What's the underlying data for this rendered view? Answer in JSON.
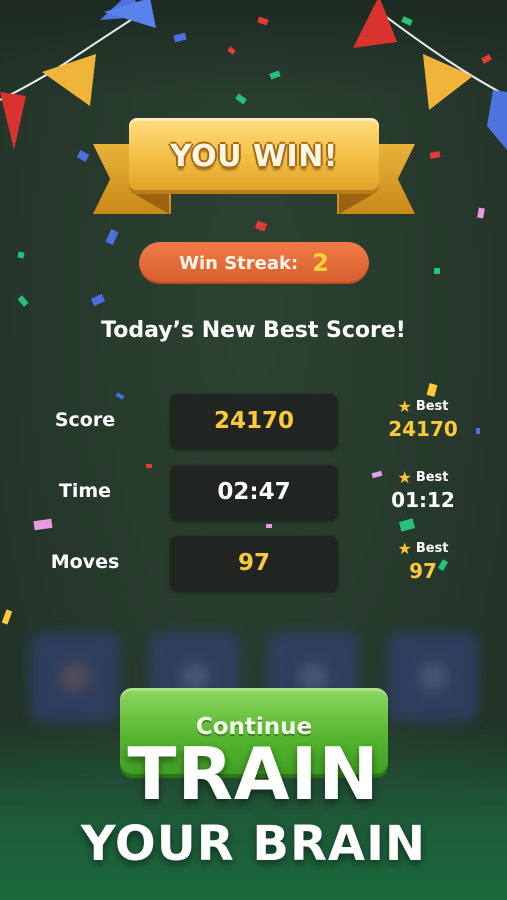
{
  "banner": {
    "title": "YOU WIN!"
  },
  "streak": {
    "label": "Win Streak:",
    "value": "2"
  },
  "subtitle": "Today’s New Best Score!",
  "stats": [
    {
      "label": "Score",
      "value": "24170",
      "best_label": "Best",
      "best_value": "24170",
      "value_color": "gold",
      "best_color": "gold"
    },
    {
      "label": "Time",
      "value": "02:47",
      "best_label": "Best",
      "best_value": "01:12",
      "value_color": "white",
      "best_color": "white"
    },
    {
      "label": "Moves",
      "value": "97",
      "best_label": "Best",
      "best_value": "97",
      "value_color": "gold",
      "best_color": "gold"
    }
  ],
  "continue_button": {
    "label": "Continue"
  },
  "promo": {
    "line1": "TRAIN",
    "line2": "YOUR BRAIN"
  },
  "colors": {
    "background": "#25372b",
    "gold": "#ffc93a",
    "streak_pill": "#e06a38",
    "continue_green": "#57b630",
    "stat_box": "#202521"
  },
  "icons": {
    "best_marker": "star-icon"
  }
}
